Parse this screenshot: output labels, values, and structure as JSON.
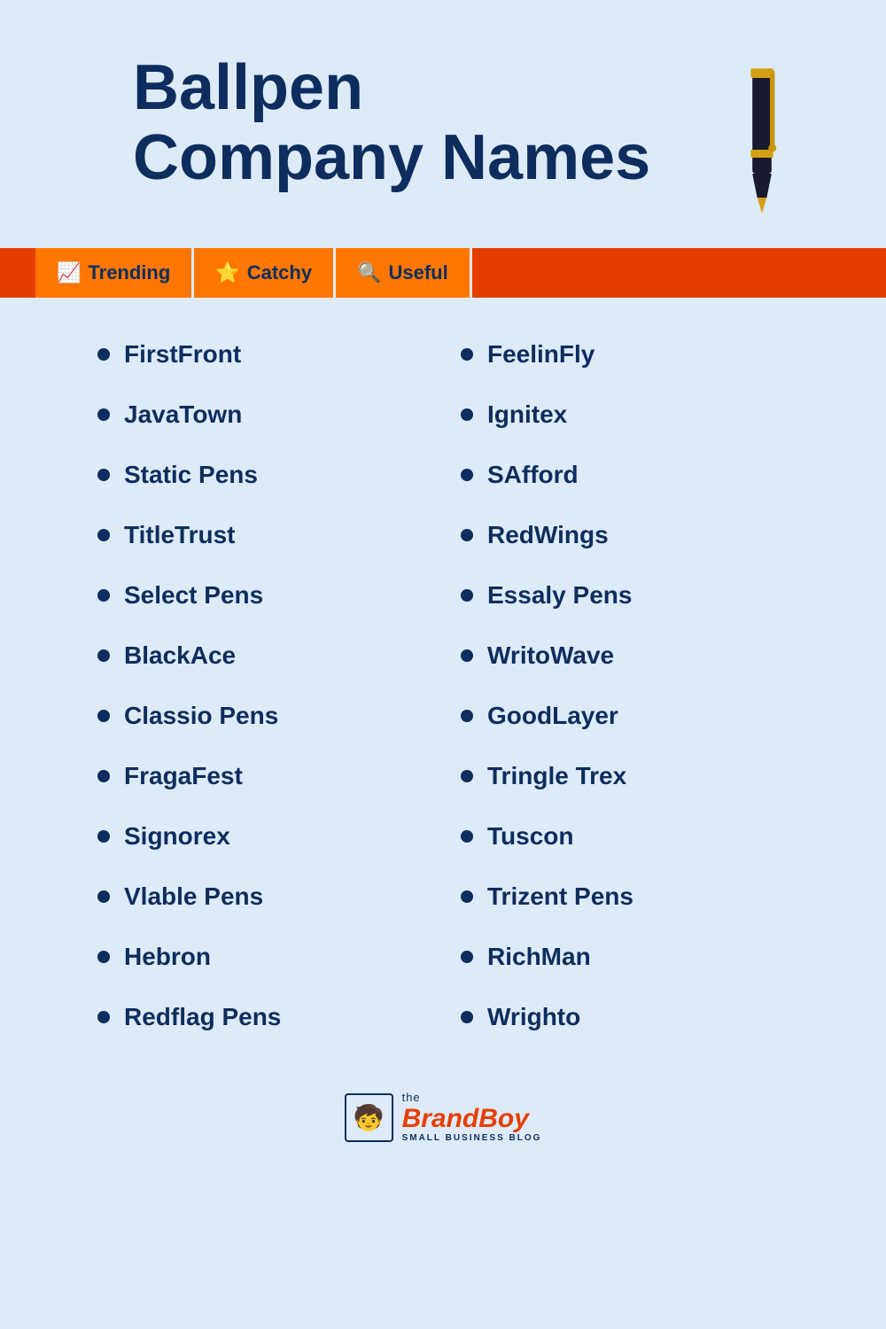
{
  "header": {
    "title_line1": "Ballpen",
    "title_line2": "Company Names"
  },
  "tags": [
    {
      "id": "trending",
      "icon": "📈",
      "label": "Trending"
    },
    {
      "id": "catchy",
      "icon": "⭐",
      "label": "Catchy"
    },
    {
      "id": "useful",
      "icon": "🔍",
      "label": "Useful"
    }
  ],
  "left_list": [
    "FirstFront",
    "JavaTown",
    "Static Pens",
    "TitleTrust",
    "Select Pens",
    "BlackAce",
    "Classio Pens",
    "FragaFest",
    "Signorex",
    "Vlable Pens",
    "Hebron",
    "Redflag Pens"
  ],
  "right_list": [
    "FeelinFly",
    "Ignitex",
    "SAfford",
    "RedWings",
    "Essaly Pens",
    "WritoWave",
    "GoodLayer",
    "Tringle Trex",
    "Tuscon",
    "Trizent Pens",
    "RichMan",
    "Wrighto"
  ],
  "brand": {
    "the": "the",
    "name_part1": "Brand",
    "name_part2": "Boy",
    "sub": "SMALL BUSINESS BLOG",
    "icon": "🧒"
  }
}
